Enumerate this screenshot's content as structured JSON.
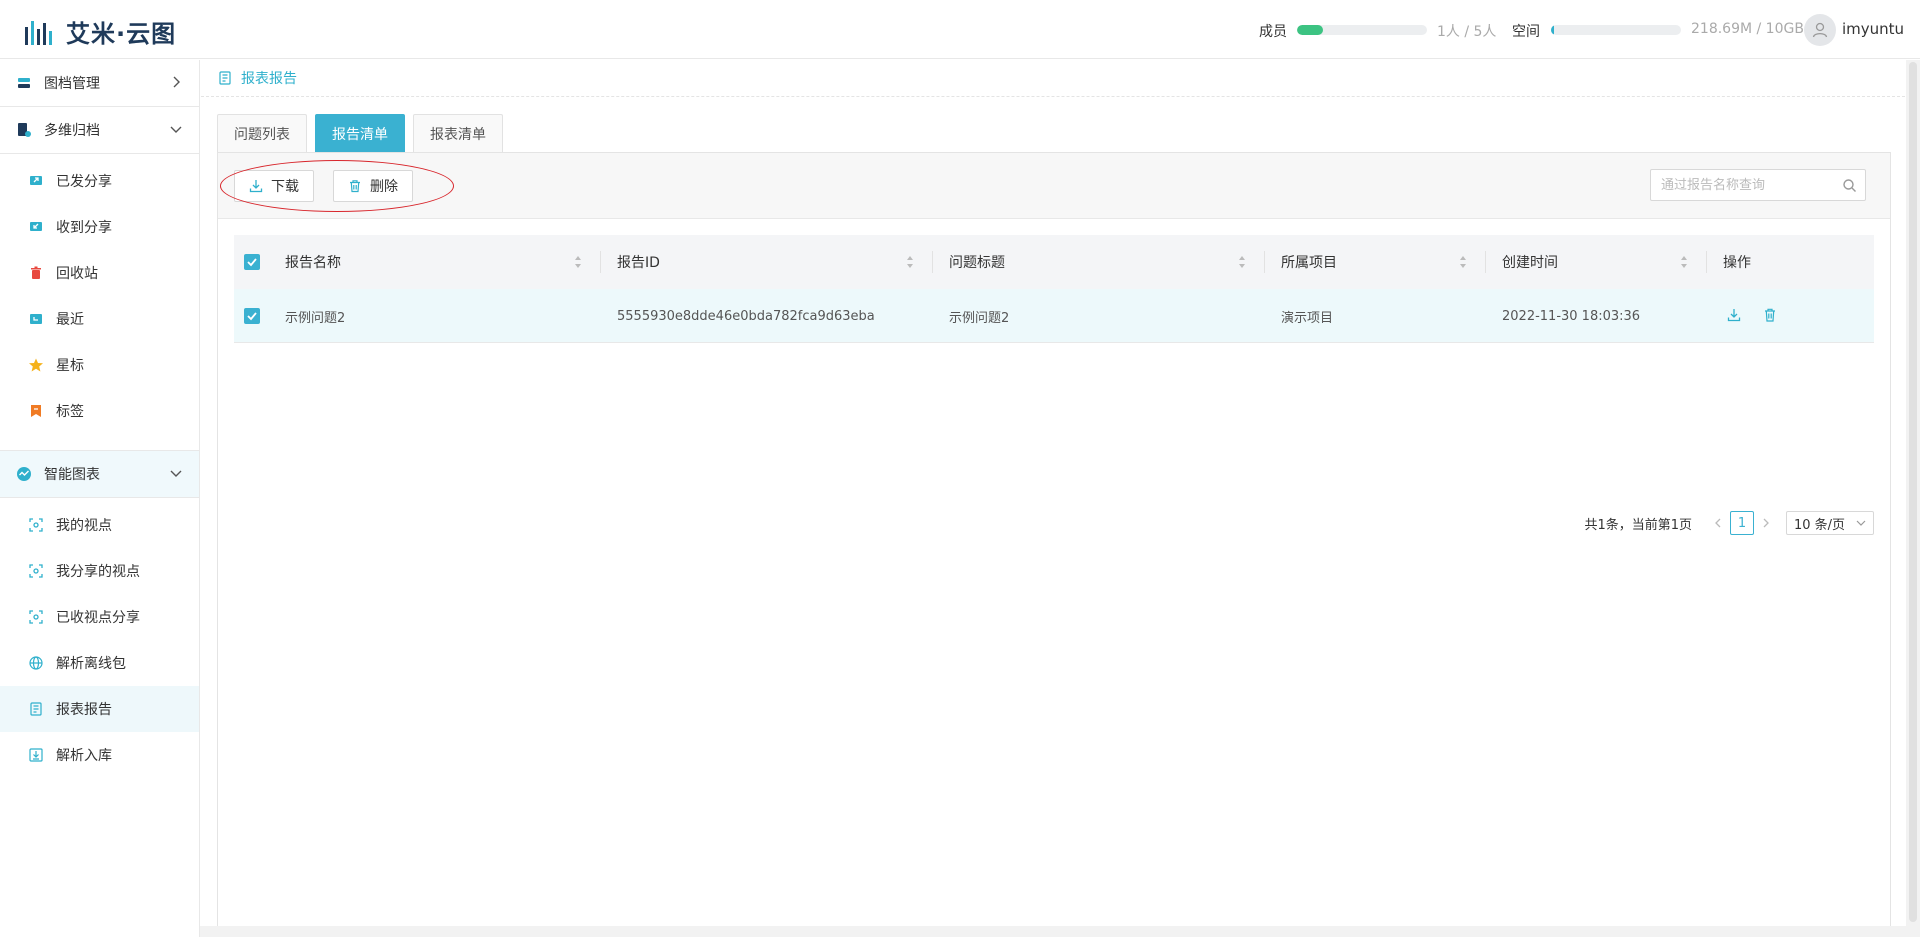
{
  "app": {
    "logo_text": "艾米·云图",
    "members_label": "成员",
    "members_value": "1人 / 5人",
    "members_fraction": 0.2,
    "space_label": "空间",
    "space_value": "218.69M / 10GB",
    "space_fraction": 0.02,
    "username": "imyuntu",
    "accent_color": "#3ab1d1"
  },
  "sidebar": {
    "groups": [
      {
        "label": "图档管理",
        "icon": "archive-icon",
        "expanded": false
      },
      {
        "label": "多维归档",
        "icon": "file-settings-icon",
        "expanded": true,
        "items": [
          {
            "label": "已发分享",
            "icon": "share-out-icon"
          },
          {
            "label": "收到分享",
            "icon": "share-in-icon"
          },
          {
            "label": "回收站",
            "icon": "trash-icon"
          },
          {
            "label": "最近",
            "icon": "recent-icon"
          },
          {
            "label": "星标",
            "icon": "star-icon"
          },
          {
            "label": "标签",
            "icon": "tag-icon"
          }
        ]
      },
      {
        "label": "智能图表",
        "icon": "smart-chart-icon",
        "expanded": true,
        "items": [
          {
            "label": "我的视点",
            "icon": "viewpoint-icon"
          },
          {
            "label": "我分享的视点",
            "icon": "viewpoint-icon"
          },
          {
            "label": "已收视点分享",
            "icon": "viewpoint-icon"
          },
          {
            "label": "解析离线包",
            "icon": "globe-icon"
          },
          {
            "label": "报表报告",
            "icon": "report-icon",
            "active": true
          },
          {
            "label": "解析入库",
            "icon": "import-icon"
          }
        ]
      }
    ]
  },
  "breadcrumb": {
    "label": "报表报告"
  },
  "tabs": [
    {
      "label": "问题列表",
      "active": false
    },
    {
      "label": "报告清单",
      "active": true
    },
    {
      "label": "报表清单",
      "active": false
    }
  ],
  "toolbar": {
    "download_label": "下载",
    "delete_label": "删除",
    "search_placeholder": "通过报告名称查询"
  },
  "table": {
    "columns": [
      "报告名称",
      "报告ID",
      "问题标题",
      "所属项目",
      "创建时间",
      "操作"
    ],
    "rows": [
      {
        "name": "示例问题2",
        "id": "5555930e8dde46e0bda782fca9d63eba",
        "title": "示例问题2",
        "project": "演示项目",
        "created": "2022-11-30 18:03:36",
        "checked": true
      }
    ]
  },
  "pagination": {
    "total_text": "共1条，当前第1页",
    "current_page": "1",
    "page_size": "10 条/页"
  }
}
